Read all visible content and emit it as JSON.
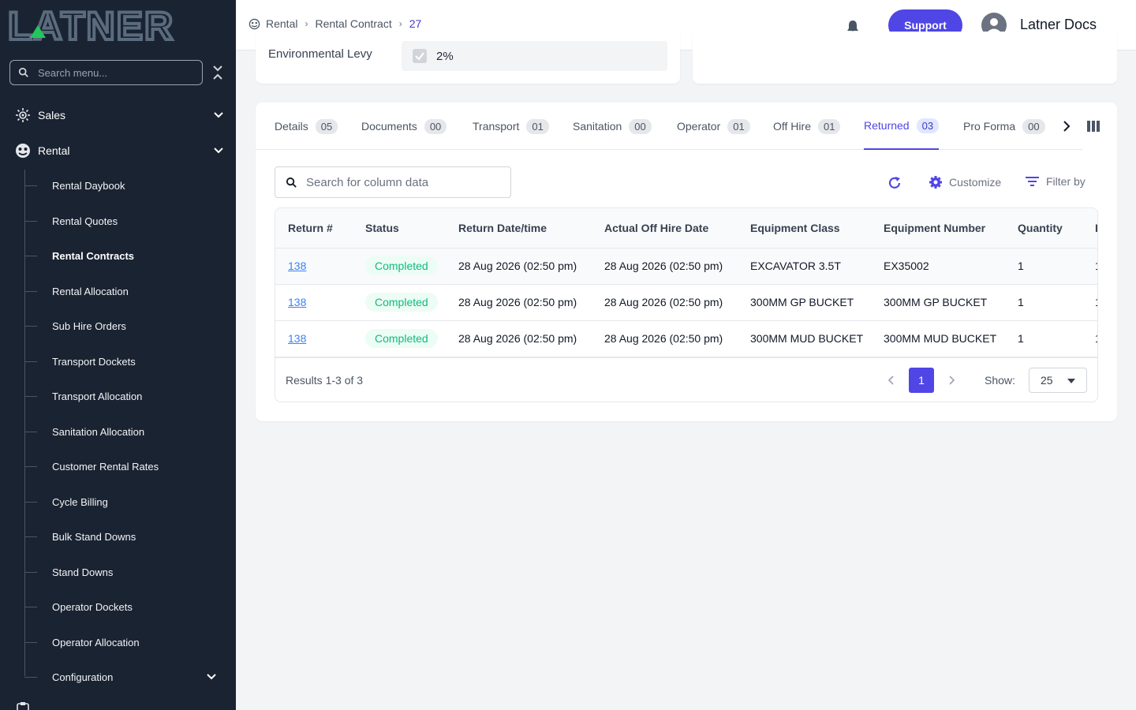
{
  "sidebar": {
    "logo": "LATNER",
    "search_placeholder": "Search menu...",
    "sections": [
      {
        "label": "Sales",
        "icon": "sales-icon"
      },
      {
        "label": "Rental",
        "icon": "rental-icon"
      }
    ],
    "rental_items": [
      "Rental Daybook",
      "Rental Quotes",
      "Rental Contracts",
      "Rental Allocation",
      "Sub Hire Orders",
      "Transport Dockets",
      "Transport Allocation",
      "Sanitation Allocation",
      "Customer Rental Rates",
      "Cycle Billing",
      "Bulk Stand Downs",
      "Stand Downs",
      "Operator Dockets",
      "Operator Allocation",
      "Configuration"
    ],
    "active_item": "Rental Contracts"
  },
  "header": {
    "breadcrumb": [
      "Rental",
      "Rental Contract",
      "27"
    ],
    "support_label": "Support",
    "user_name": "Latner Docs"
  },
  "top_card": {
    "levy_label": "Environmental Levy",
    "levy_value": "2%"
  },
  "tabs": [
    {
      "label": "Details",
      "count": "05"
    },
    {
      "label": "Documents",
      "count": "00"
    },
    {
      "label": "Transport",
      "count": "01"
    },
    {
      "label": "Sanitation",
      "count": "00"
    },
    {
      "label": "Operator",
      "count": "01"
    },
    {
      "label": "Off Hire",
      "count": "01"
    },
    {
      "label": "Returned",
      "count": "03"
    },
    {
      "label": "Pro Forma",
      "count": "00"
    }
  ],
  "active_tab": "Returned",
  "toolbar": {
    "search_placeholder": "Search for column data",
    "customize_label": "Customize",
    "filter_label": "Filter by"
  },
  "table": {
    "columns": [
      "Return #",
      "Status",
      "Return Date/time",
      "Actual Off Hire Date",
      "Equipment Class",
      "Equipment Number",
      "Quantity",
      "I"
    ],
    "rows": [
      [
        "138",
        "Completed",
        "28 Aug 2026 (02:50 pm)",
        "28 Aug 2026 (02:50 pm)",
        "EXCAVATOR 3.5T",
        "EX35002",
        "1",
        "1"
      ],
      [
        "138",
        "Completed",
        "28 Aug 2026 (02:50 pm)",
        "28 Aug 2026 (02:50 pm)",
        "300MM GP BUCKET",
        "300MM GP BUCKET",
        "1",
        "1"
      ],
      [
        "138",
        "Completed",
        "28 Aug 2026 (02:50 pm)",
        "28 Aug 2026 (02:50 pm)",
        "300MM MUD BUCKET",
        "300MM MUD BUCKET",
        "1",
        "1"
      ]
    ]
  },
  "pagination": {
    "results": "Results 1-3 of 3",
    "current_page": "1",
    "show_label": "Show:",
    "page_size": "25"
  },
  "colors": {
    "sidebar_bg": "#1a2332",
    "accent": "#4f46e5",
    "logo": "#5a6b7d",
    "logo_accent": "#22c55e",
    "status_completed": "#10b981"
  }
}
